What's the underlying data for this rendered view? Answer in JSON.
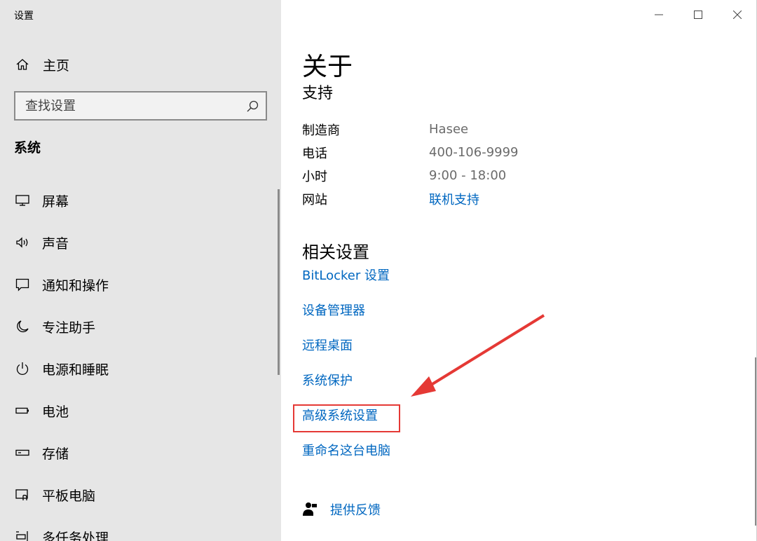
{
  "app": {
    "title": "设置"
  },
  "sidebar": {
    "home_label": "主页",
    "search_placeholder": "查找设置",
    "section_title": "系统",
    "items": [
      {
        "label": "屏幕",
        "icon": "monitor-icon"
      },
      {
        "label": "声音",
        "icon": "speaker-icon"
      },
      {
        "label": "通知和操作",
        "icon": "notification-icon"
      },
      {
        "label": "专注助手",
        "icon": "moon-icon"
      },
      {
        "label": "电源和睡眠",
        "icon": "power-icon"
      },
      {
        "label": "电池",
        "icon": "battery-icon"
      },
      {
        "label": "存储",
        "icon": "storage-icon"
      },
      {
        "label": "平板电脑",
        "icon": "tablet-icon"
      },
      {
        "label": "多任务处理",
        "icon": "multitask-icon"
      }
    ]
  },
  "main": {
    "title": "关于",
    "support": {
      "title": "支持",
      "rows": [
        {
          "key": "制造商",
          "value": "Hasee"
        },
        {
          "key": "电话",
          "value": "400-106-9999"
        },
        {
          "key": "小时",
          "value": "9:00 - 18:00"
        },
        {
          "key": "网站",
          "value": "联机支持"
        }
      ]
    },
    "related": {
      "title": "相关设置",
      "links": [
        "BitLocker 设置",
        "设备管理器",
        "远程桌面",
        "系统保护",
        "高级系统设置",
        "重命名这台电脑"
      ],
      "highlighted_link": "高级系统设置"
    },
    "feedback_label": "提供反馈"
  },
  "colors": {
    "sidebar_bg": "#e6e6e6",
    "link": "#0067c0",
    "annotation": "#e53935"
  }
}
